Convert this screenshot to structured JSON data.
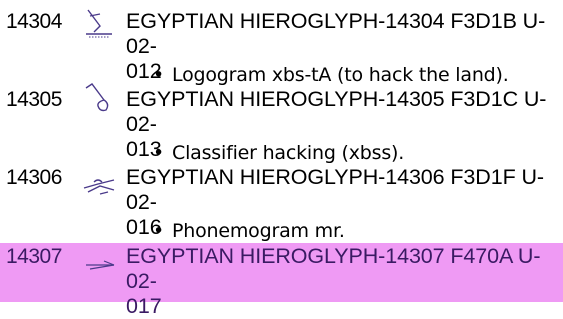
{
  "colors": {
    "highlight_bg": "#ef9af4",
    "highlight_text": "#3a1a63",
    "glyph_stroke": "#4a3a8a"
  },
  "entries": [
    {
      "code": "14304",
      "glyph_icon": "hoe-hacking-land-glyph",
      "desc_line1": "EGYPTIAN HIEROGLYPH-14304 F3D1B U-02-",
      "desc_line2": "012",
      "note": "Logogram xbs-tA (to hack the land).",
      "highlighted": false
    },
    {
      "code": "14305",
      "glyph_icon": "hoe-glyph",
      "desc_line1": "EGYPTIAN HIEROGLYPH-14305 F3D1C U-02-",
      "desc_line2": "013",
      "note": "Classifier hacking (xbss).",
      "highlighted": false
    },
    {
      "code": "14306",
      "glyph_icon": "plough-glyph",
      "desc_line1": "EGYPTIAN HIEROGLYPH-14306 F3D1F U-02-",
      "desc_line2": "016",
      "note": "Phonemogram mr.",
      "highlighted": false
    },
    {
      "code": "14307",
      "glyph_icon": "pick-glyph",
      "desc_line1": "EGYPTIAN HIEROGLYPH-14307 F470A U-02-",
      "desc_line2": "017",
      "note": "",
      "highlighted": true
    }
  ],
  "bullet": "•"
}
